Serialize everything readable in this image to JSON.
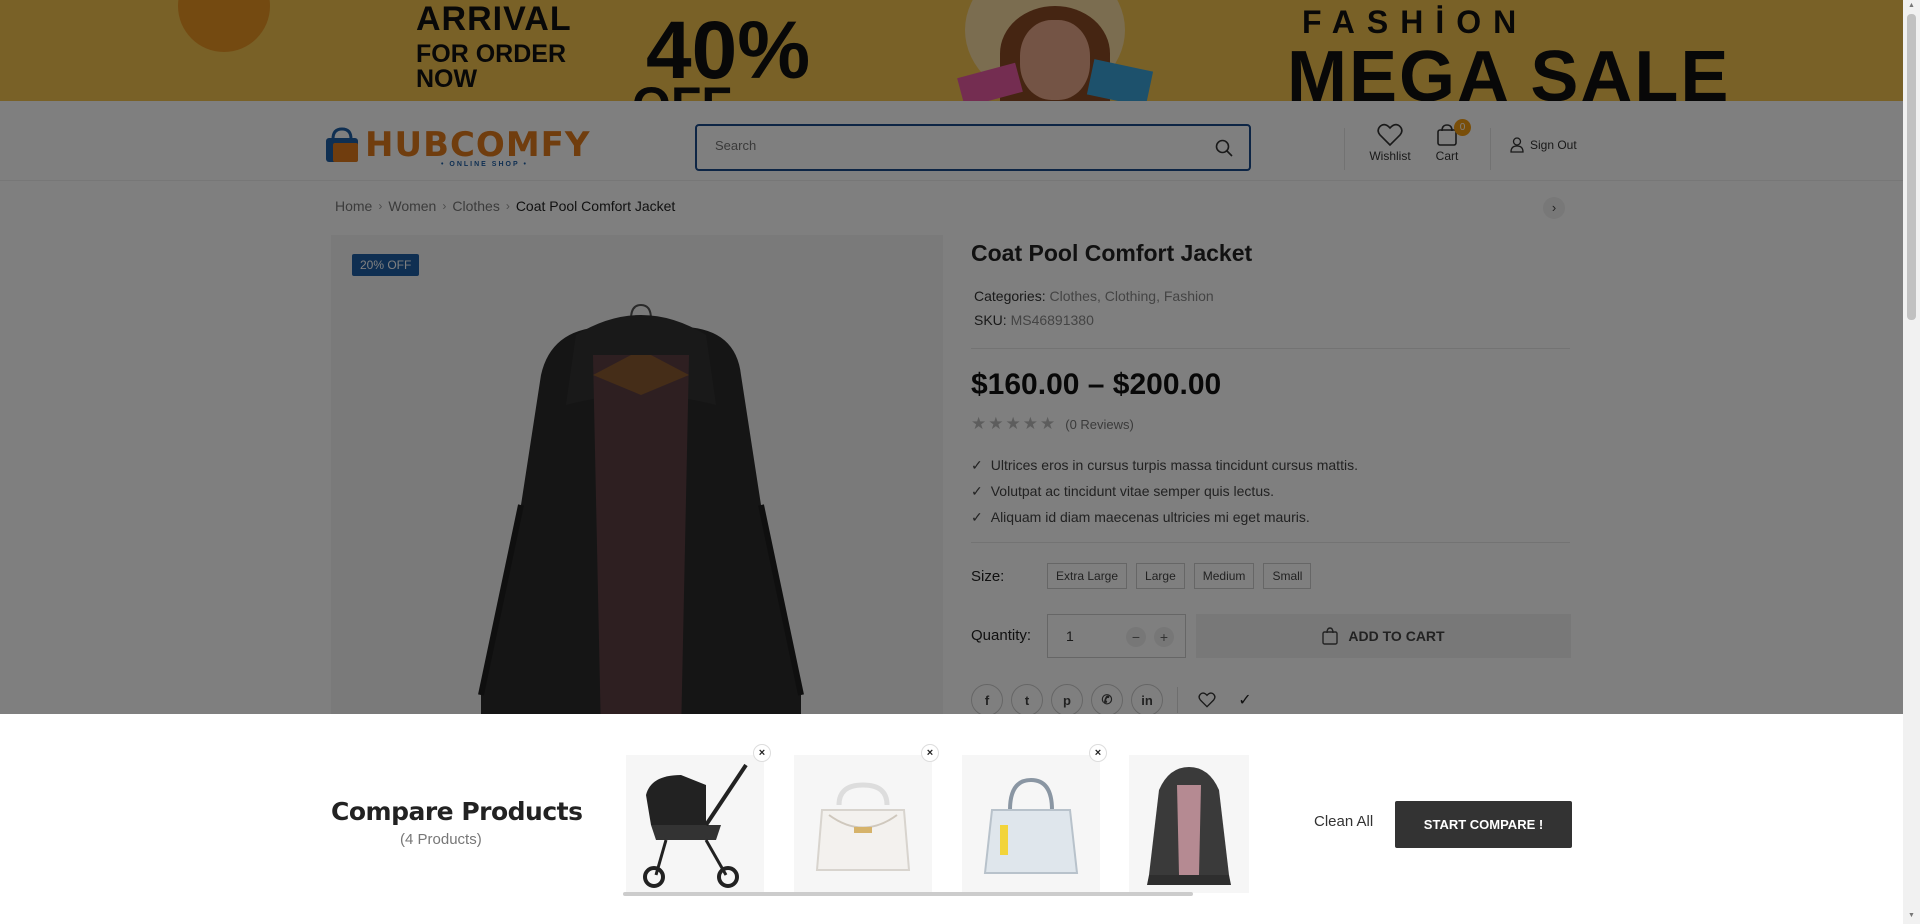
{
  "banner": {
    "arrival": "ARRIVAL",
    "for_order": "FOR ORDER",
    "now": "NOW",
    "percent": "40%",
    "off": "OFF",
    "fashion": "FASHİON",
    "mega_sale": "MEGA SALE"
  },
  "header": {
    "logo_text": "HUBCOMFY",
    "logo_sub": "• ONLINE SHOP •",
    "search_placeholder": "Search",
    "wishlist_label": "Wishlist",
    "cart_label": "Cart",
    "cart_count": "0",
    "sign_out_label": "Sign Out"
  },
  "breadcrumb": [
    "Home",
    "Women",
    "Clothes",
    "Coat Pool Comfort Jacket"
  ],
  "product": {
    "badge": "20% OFF",
    "title": "Coat Pool Comfort Jacket",
    "categories_label": "Categories:",
    "categories_value": "Clothes, Clothing, Fashion",
    "sku_label": "SKU:",
    "sku_value": "MS46891380",
    "price": "$160.00 – $200.00",
    "rating": 0,
    "reviews": "(0 Reviews)",
    "features": [
      "Ultrices eros in cursus turpis massa tincidunt cursus mattis.",
      "Volutpat ac tincidunt vitae semper quis lectus.",
      "Aliquam id diam maecenas ultricies mi eget mauris."
    ],
    "size_label": "Size:",
    "sizes": [
      "Extra Large",
      "Large",
      "Medium",
      "Small"
    ],
    "quantity_label": "Quantity:",
    "quantity": "1",
    "add_to_cart": "ADD TO CART"
  },
  "compare": {
    "title": "Compare Products",
    "count": "(4 Products)",
    "items": [
      "stroller",
      "white-handbag",
      "grey-handbag",
      "coat"
    ],
    "clean_all": "Clean All",
    "start": "START COMPARE !"
  },
  "colors": {
    "accent": "#1f5fa5",
    "brand_orange": "#e07b1d",
    "banner_bg": "#f3c24f"
  }
}
